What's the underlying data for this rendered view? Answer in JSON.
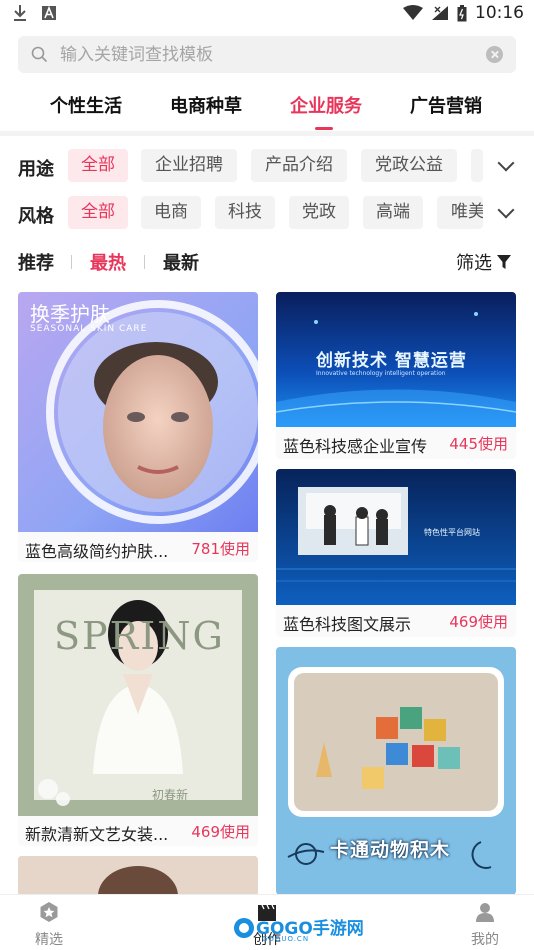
{
  "status_bar": {
    "time": "10:16"
  },
  "search": {
    "placeholder": "输入关键词查找模板"
  },
  "top_tabs": [
    {
      "label": "个性生活"
    },
    {
      "label": "电商种草"
    },
    {
      "label": "企业服务",
      "active": true
    },
    {
      "label": "广告营销"
    }
  ],
  "filters": {
    "usage": {
      "label": "用途",
      "options": [
        "全部",
        "企业招聘",
        "产品介绍",
        "党政公益"
      ]
    },
    "style": {
      "label": "风格",
      "options": [
        "全部",
        "电商",
        "科技",
        "党政",
        "高端",
        "唯美"
      ]
    }
  },
  "sort": {
    "options": [
      "推荐",
      "最热",
      "最新"
    ],
    "active": "最热",
    "filter_label": "筛选"
  },
  "cards": [
    {
      "title": "蓝色高级简约护肤...",
      "uses": "781使用",
      "art_title": "换季护肤",
      "art_subtitle": "SEASONAL SKIN CARE"
    },
    {
      "title": "蓝色科技感企业宣传",
      "uses": "445使用",
      "art_title": "创新技术 智慧运营",
      "art_subtitle": "Innovative technology intelligent operation"
    },
    {
      "title": "蓝色科技图文展示",
      "uses": "469使用",
      "art_title": "特色性平台网站"
    },
    {
      "title": "新款清新文艺女装...",
      "uses": "469使用",
      "art_title": "SPRING",
      "art_subtitle": "初春新"
    },
    {
      "title": "",
      "uses": "",
      "art_title": "卡通动物积木"
    }
  ],
  "bottom_nav": [
    {
      "label": "精选",
      "icon": "star-icon"
    },
    {
      "label": "创作",
      "icon": "clapper-icon"
    },
    {
      "label": "我的",
      "icon": "user-icon"
    }
  ],
  "watermark": {
    "text": "GOGO手游网",
    "url": "GOGUO.CN"
  },
  "colors": {
    "accent": "#e8365b",
    "chip_bg": "#f3f3f3",
    "chip_active_bg": "#fde8ec"
  }
}
